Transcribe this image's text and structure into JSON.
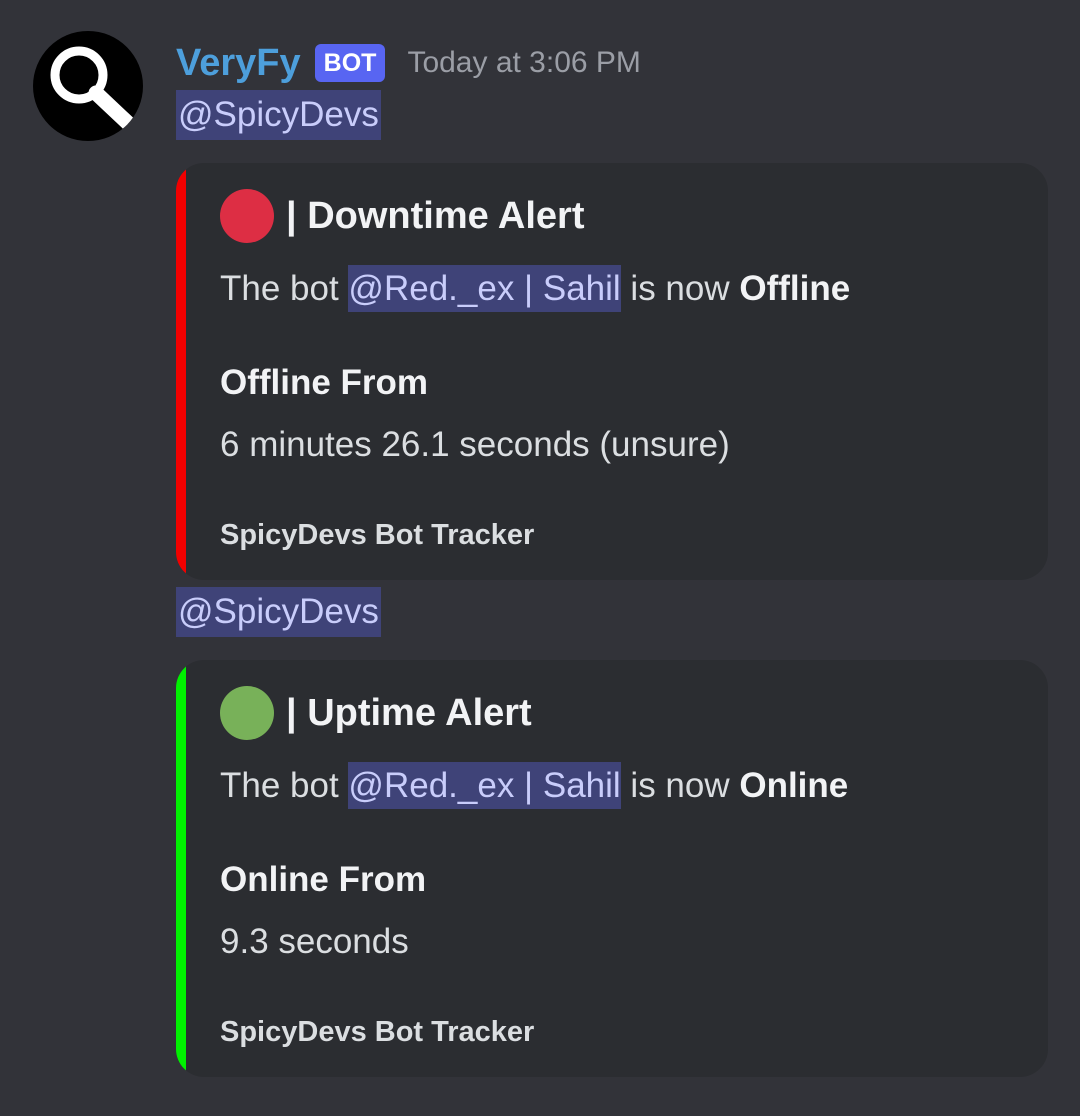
{
  "message": {
    "author": "VeryFy",
    "bot_tag": "BOT",
    "timestamp": "Today at 3:06 PM"
  },
  "embeds": [
    {
      "mention": "@SpicyDevs",
      "bar_color": "#f20000",
      "icon_color": "#dd2e44",
      "title": "| Downtime Alert",
      "desc_prefix": "The bot ",
      "bot_mention": "@Red._ex | Sahil",
      "desc_middle": " is now ",
      "status": "Offline",
      "field_name": "Offline From",
      "field_value": "6 minutes 26.1 seconds (unsure)",
      "footer": "SpicyDevs Bot Tracker"
    },
    {
      "mention": "@SpicyDevs",
      "bar_color": "#00f000",
      "icon_color": "#78b159",
      "title": "| Uptime Alert",
      "desc_prefix": "The bot ",
      "bot_mention": "@Red._ex | Sahil",
      "desc_middle": " is now ",
      "status": "Online",
      "field_name": "Online From",
      "field_value": "9.3 seconds",
      "footer": "SpicyDevs Bot Tracker"
    }
  ]
}
